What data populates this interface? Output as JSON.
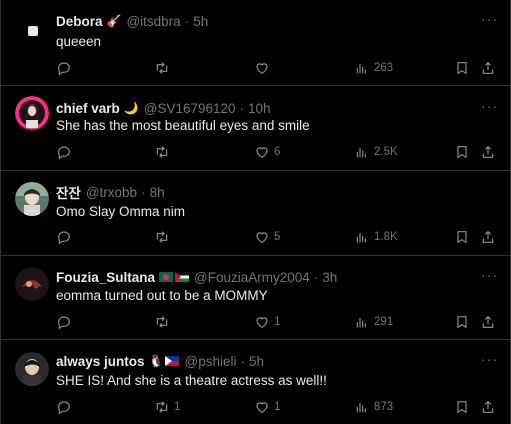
{
  "tweets": [
    {
      "name": "Debora",
      "emoji": "🎸",
      "handle": "@itsdbra",
      "time": "5h",
      "text": "queeen",
      "replies": "",
      "reposts": "",
      "likes": "",
      "views": "263"
    },
    {
      "name": "chief varb",
      "emoji": "🌙",
      "handle": "@SV16796120",
      "time": "10h",
      "text": "She has the most beautiful eyes and smile",
      "replies": "",
      "reposts": "",
      "likes": "6",
      "views": "2.5K"
    },
    {
      "name": "잔잔",
      "emoji": "",
      "handle": "@trxobb",
      "time": "8h",
      "text": "Omo Slay Omma nim",
      "replies": "",
      "reposts": "",
      "likes": "5",
      "views": "1.8K"
    },
    {
      "name": "Fouzia_Sultana",
      "emoji": "",
      "handle": "@FouziaArmy2004",
      "time": "3h",
      "text": "eomma turned out to be a MOMMY",
      "replies": "",
      "reposts": "",
      "likes": "1",
      "views": "291"
    },
    {
      "name": "always juntos",
      "emoji": "🐧",
      "handle": "@pshieli",
      "time": "5h",
      "text": "SHE IS! And she is a theatre actress as well!!",
      "replies": "",
      "reposts": "1",
      "likes": "1",
      "views": "873"
    }
  ],
  "separator": "·",
  "more_glyph": "···",
  "colors": {
    "background": "#000000",
    "text": "#e7e9ea",
    "muted": "#71767b",
    "border": "#2f3336"
  }
}
